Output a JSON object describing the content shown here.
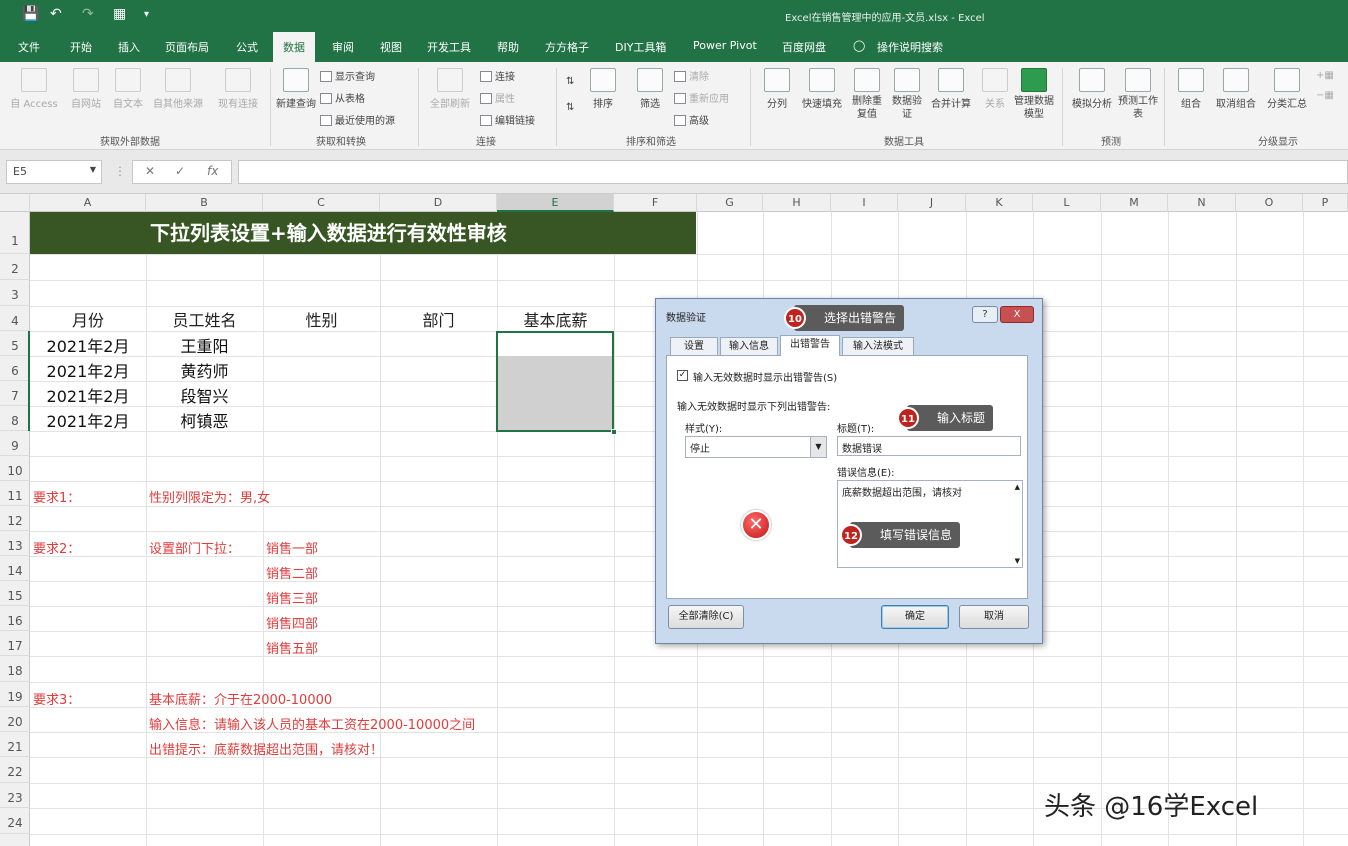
{
  "titlebar": {
    "file_title": "Excel在销售管理中的应用-文员.xlsx - Excel"
  },
  "tabs": [
    "文件",
    "开始",
    "插入",
    "页面布局",
    "公式",
    "数据",
    "审阅",
    "视图",
    "开发工具",
    "帮助",
    "方方格子",
    "DIY工具箱",
    "Power Pivot",
    "百度网盘",
    "操作说明搜索"
  ],
  "ribbon": {
    "get_external": [
      "自 Access",
      "自网站",
      "自文本",
      "自其他来源",
      "现有连接"
    ],
    "get_transform": {
      "new_query": "新建查询",
      "show_queries": "显示查询",
      "from_table": "从表格",
      "recent_sources": "最近使用的源"
    },
    "connections": {
      "refresh_all": "全部刷新",
      "connections": "连接",
      "properties": "属性",
      "edit_links": "编辑链接"
    },
    "sort_filter": {
      "sort": "排序",
      "filter": "筛选",
      "clear": "清除",
      "reapply": "重新应用",
      "advanced": "高级"
    },
    "data_tools": [
      "分列",
      "快速填充",
      "删除重复值",
      "数据验证",
      "合并计算",
      "关系",
      "管理数据模型"
    ],
    "forecast": [
      "模拟分析",
      "预测工作表"
    ],
    "outline": [
      "组合",
      "取消组合",
      "分类汇总"
    ],
    "groups": [
      "获取外部数据",
      "获取和转换",
      "连接",
      "排序和筛选",
      "数据工具",
      "预测",
      "分级显示"
    ]
  },
  "formula_bar": {
    "name_box": "E5",
    "fx": "fx"
  },
  "columns": [
    "A",
    "B",
    "C",
    "D",
    "E",
    "F",
    "G",
    "H",
    "I",
    "J",
    "K",
    "L",
    "M",
    "N",
    "O",
    "P"
  ],
  "rows": [
    "1",
    "2",
    "3",
    "4",
    "5",
    "6",
    "7",
    "8",
    "9",
    "10",
    "11",
    "12",
    "13",
    "14",
    "15",
    "16",
    "17",
    "18",
    "19",
    "20",
    "21",
    "22",
    "23",
    "24"
  ],
  "sheet": {
    "banner": "下拉列表设置+输入数据进行有效性审核",
    "headers": [
      "月份",
      "员工姓名",
      "性别",
      "部门",
      "基本底薪"
    ],
    "months": [
      "2021年2月",
      "2021年2月",
      "2021年2月",
      "2021年2月"
    ],
    "names": [
      "王重阳",
      "黄药师",
      "段智兴",
      "柯镇恶"
    ],
    "req1_label": "要求1：",
    "req1_text": "性别列限定为：男,女",
    "req2_label": "要求2：",
    "req2_text": "设置部门下拉：",
    "departments": [
      "销售一部",
      "销售二部",
      "销售三部",
      "销售四部",
      "销售五部"
    ],
    "req3_label": "要求3：",
    "req3_lines": [
      "基本底薪：介于在2000-10000",
      "输入信息：请输入该人员的基本工资在2000-10000之间",
      "出错提示：底薪数据超出范围，请核对！"
    ]
  },
  "dialog": {
    "title": "数据验证",
    "help": "?",
    "close": "X",
    "tabs": [
      "设置",
      "输入信息",
      "出错警告",
      "输入法模式"
    ],
    "checkbox_label": "输入无效数据时显示出错警告(S)",
    "section_label": "输入无效数据时显示下列出错警告:",
    "style_label": "样式(Y):",
    "style_value": "停止",
    "title_label": "标题(T):",
    "title_value": "数据错误",
    "msg_label": "错误信息(E):",
    "msg_value": "底薪数据超出范围，请核对",
    "clear_all": "全部清除(C)",
    "ok": "确定",
    "cancel": "取消"
  },
  "callouts": [
    {
      "num": "10",
      "text": "选择出错警告"
    },
    {
      "num": "11",
      "text": "输入标题"
    },
    {
      "num": "12",
      "text": "填写错误信息"
    }
  ],
  "watermark": "头条 @16学Excel",
  "colors": {
    "excel_green": "#217346",
    "banner": "#375623",
    "red_text": "#e23b3b",
    "callout": "#5b5b5b",
    "callout_num": "#c0231d"
  }
}
